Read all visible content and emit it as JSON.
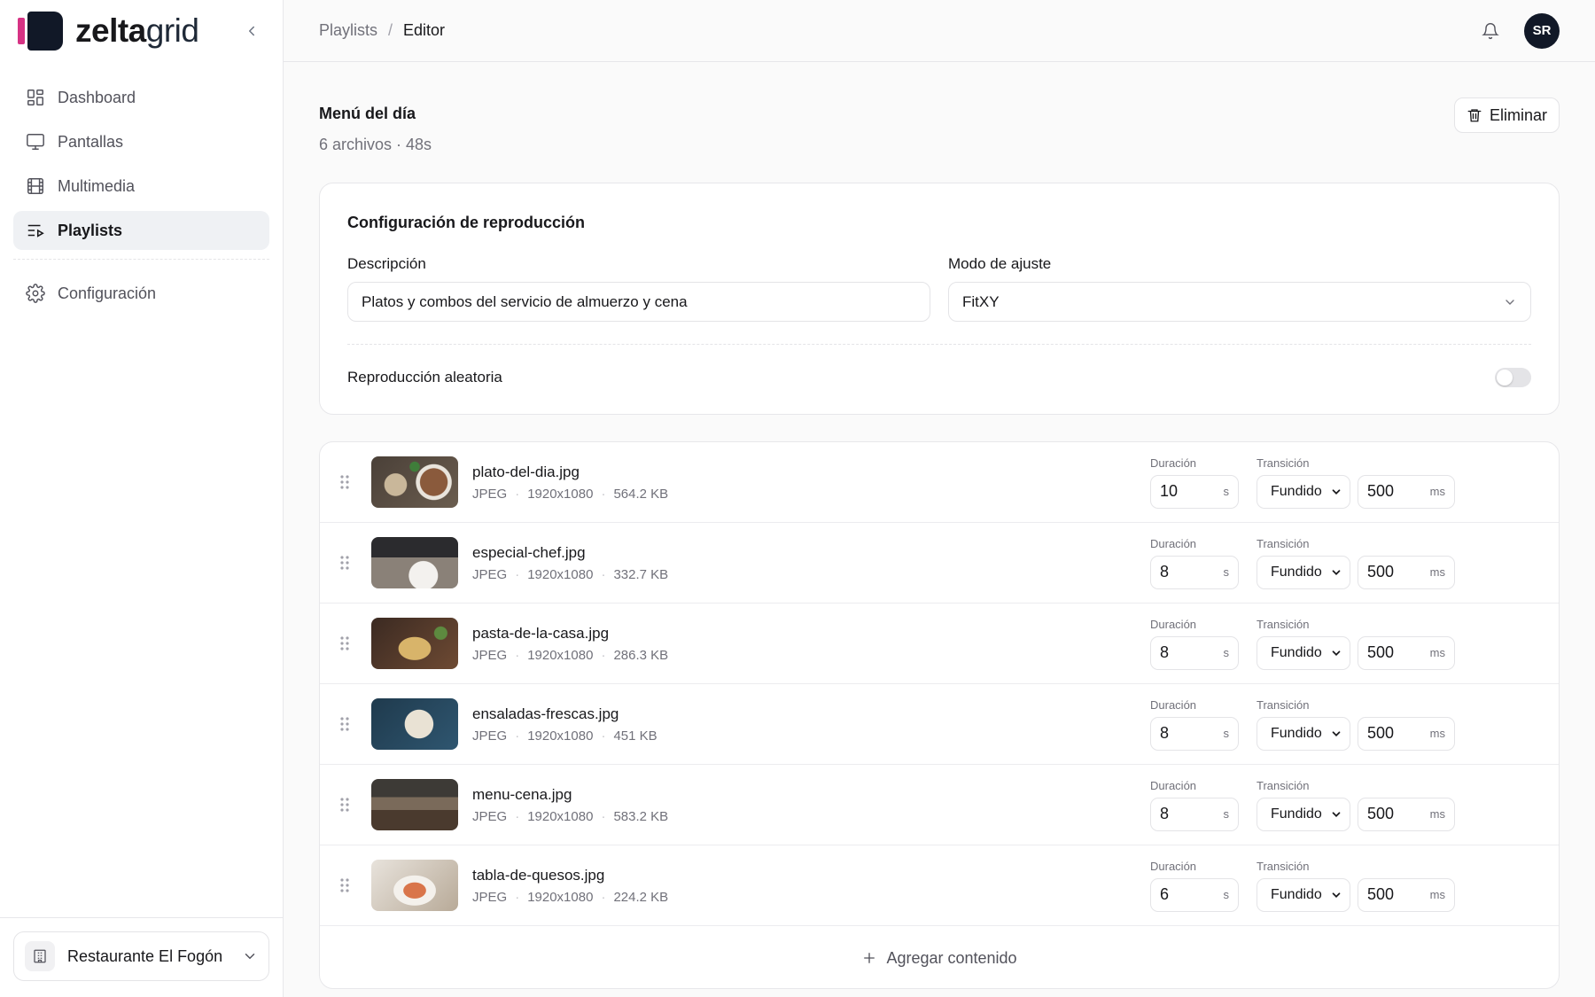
{
  "brand": {
    "name_bold": "zelta",
    "name_light": "grid"
  },
  "sidebar": {
    "items": [
      {
        "label": "Dashboard",
        "icon": "dashboard-icon"
      },
      {
        "label": "Pantallas",
        "icon": "monitor-icon"
      },
      {
        "label": "Multimedia",
        "icon": "film-icon"
      },
      {
        "label": "Playlists",
        "icon": "playlist-icon",
        "active": true
      },
      {
        "label": "Configuración",
        "icon": "gear-icon"
      }
    ],
    "org": "Restaurante El Fogón"
  },
  "breadcrumb": {
    "parent": "Playlists",
    "separator": "/",
    "current": "Editor"
  },
  "user": {
    "initials": "SR"
  },
  "page": {
    "title": "Menú del día",
    "subtitle": "6 archivos · 48s",
    "delete_label": "Eliminar"
  },
  "config": {
    "title": "Configuración de reproducción",
    "description_label": "Descripción",
    "description_value": "Platos y combos del servicio de almuerzo y cena",
    "mode_label": "Modo de ajuste",
    "mode_value": "FitXY",
    "shuffle_label": "Reproducción aleatoria",
    "shuffle_on": false
  },
  "list_labels": {
    "duration": "Duración",
    "transition": "Transición",
    "sec_unit": "s",
    "ms_unit": "ms"
  },
  "items": [
    {
      "name": "plato-del-dia.jpg",
      "format": "JPEG",
      "resolution": "1920x1080",
      "size": "564.2 KB",
      "duration": "10",
      "transition": "Fundido",
      "transition_ms": "500"
    },
    {
      "name": "especial-chef.jpg",
      "format": "JPEG",
      "resolution": "1920x1080",
      "size": "332.7 KB",
      "duration": "8",
      "transition": "Fundido",
      "transition_ms": "500"
    },
    {
      "name": "pasta-de-la-casa.jpg",
      "format": "JPEG",
      "resolution": "1920x1080",
      "size": "286.3 KB",
      "duration": "8",
      "transition": "Fundido",
      "transition_ms": "500"
    },
    {
      "name": "ensaladas-frescas.jpg",
      "format": "JPEG",
      "resolution": "1920x1080",
      "size": "451 KB",
      "duration": "8",
      "transition": "Fundido",
      "transition_ms": "500"
    },
    {
      "name": "menu-cena.jpg",
      "format": "JPEG",
      "resolution": "1920x1080",
      "size": "583.2 KB",
      "duration": "8",
      "transition": "Fundido",
      "transition_ms": "500"
    },
    {
      "name": "tabla-de-quesos.jpg",
      "format": "JPEG",
      "resolution": "1920x1080",
      "size": "224.2 KB",
      "duration": "6",
      "transition": "Fundido",
      "transition_ms": "500"
    }
  ],
  "add_label": "Agregar contenido",
  "colors": {
    "brand_pink": "#d63384",
    "brand_dark": "#111827",
    "active_nav_bg": "#eff1f4"
  }
}
